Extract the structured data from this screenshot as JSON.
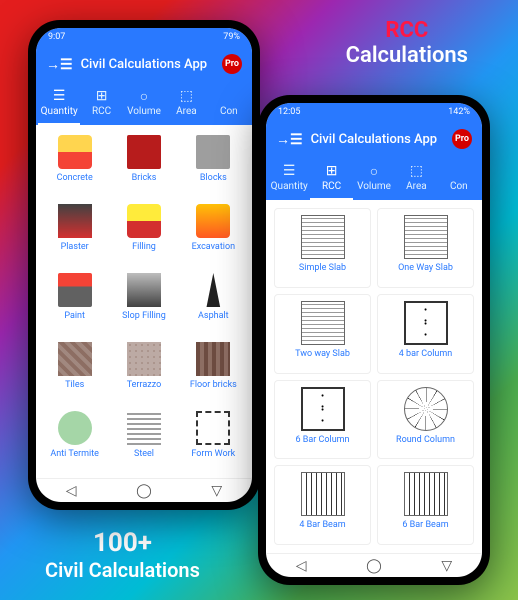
{
  "promoTop": {
    "line1": "RCC",
    "line2": "Calculations"
  },
  "promoBottom": {
    "line1": "100+",
    "line2": "Civil Calculations"
  },
  "phone1": {
    "status": {
      "time": "9:07",
      "battery": "79%"
    },
    "appTitle": "Civil Calculations App",
    "proBadge": "Pro",
    "tabs": [
      {
        "label": "Quantity",
        "icon": "☰"
      },
      {
        "label": "RCC",
        "icon": "⊞"
      },
      {
        "label": "Volume",
        "icon": "○"
      },
      {
        "label": "Area",
        "icon": "⬚"
      },
      {
        "label": "Con",
        "icon": ""
      }
    ],
    "activeTab": 0,
    "items": [
      {
        "label": "Concrete",
        "icon": "ic-concrete"
      },
      {
        "label": "Bricks",
        "icon": "ic-brick"
      },
      {
        "label": "Blocks",
        "icon": "ic-block"
      },
      {
        "label": "Plaster",
        "icon": "ic-plaster"
      },
      {
        "label": "Filling",
        "icon": "ic-filling"
      },
      {
        "label": "Excavation",
        "icon": "ic-excav"
      },
      {
        "label": "Paint",
        "icon": "ic-paint"
      },
      {
        "label": "Slop Filling",
        "icon": "ic-slop"
      },
      {
        "label": "Asphalt",
        "icon": "ic-asphalt"
      },
      {
        "label": "Tiles",
        "icon": "ic-tiles"
      },
      {
        "label": "Terrazzo",
        "icon": "ic-terrazzo"
      },
      {
        "label": "Floor bricks",
        "icon": "ic-floor"
      },
      {
        "label": "Anti Termite",
        "icon": "ic-anti"
      },
      {
        "label": "Steel",
        "icon": "ic-steel"
      },
      {
        "label": "Form Work",
        "icon": "ic-form"
      }
    ]
  },
  "phone2": {
    "status": {
      "time": "12:05",
      "battery": "142%"
    },
    "appTitle": "Civil Calculations App",
    "proBadge": "Pro",
    "tabs": [
      {
        "label": "Quantity",
        "icon": "☰"
      },
      {
        "label": "RCC",
        "icon": "⊞"
      },
      {
        "label": "Volume",
        "icon": "○"
      },
      {
        "label": "Area",
        "icon": "⬚"
      },
      {
        "label": "Con",
        "icon": ""
      }
    ],
    "activeTab": 1,
    "items": [
      {
        "label": "Simple Slab",
        "icon": "sq-grid"
      },
      {
        "label": "One Way Slab",
        "icon": "sq-grid"
      },
      {
        "label": "Two way Slab",
        "icon": "sq-grid"
      },
      {
        "label": "4 bar Column",
        "icon": "sq-dots"
      },
      {
        "label": "6 Bar Column",
        "icon": "sq-dots"
      },
      {
        "label": "Round Column",
        "icon": "sq-round"
      },
      {
        "label": "4 Bar Beam",
        "icon": "sq-beam"
      },
      {
        "label": "6 Bar Beam",
        "icon": "sq-beam"
      }
    ]
  }
}
